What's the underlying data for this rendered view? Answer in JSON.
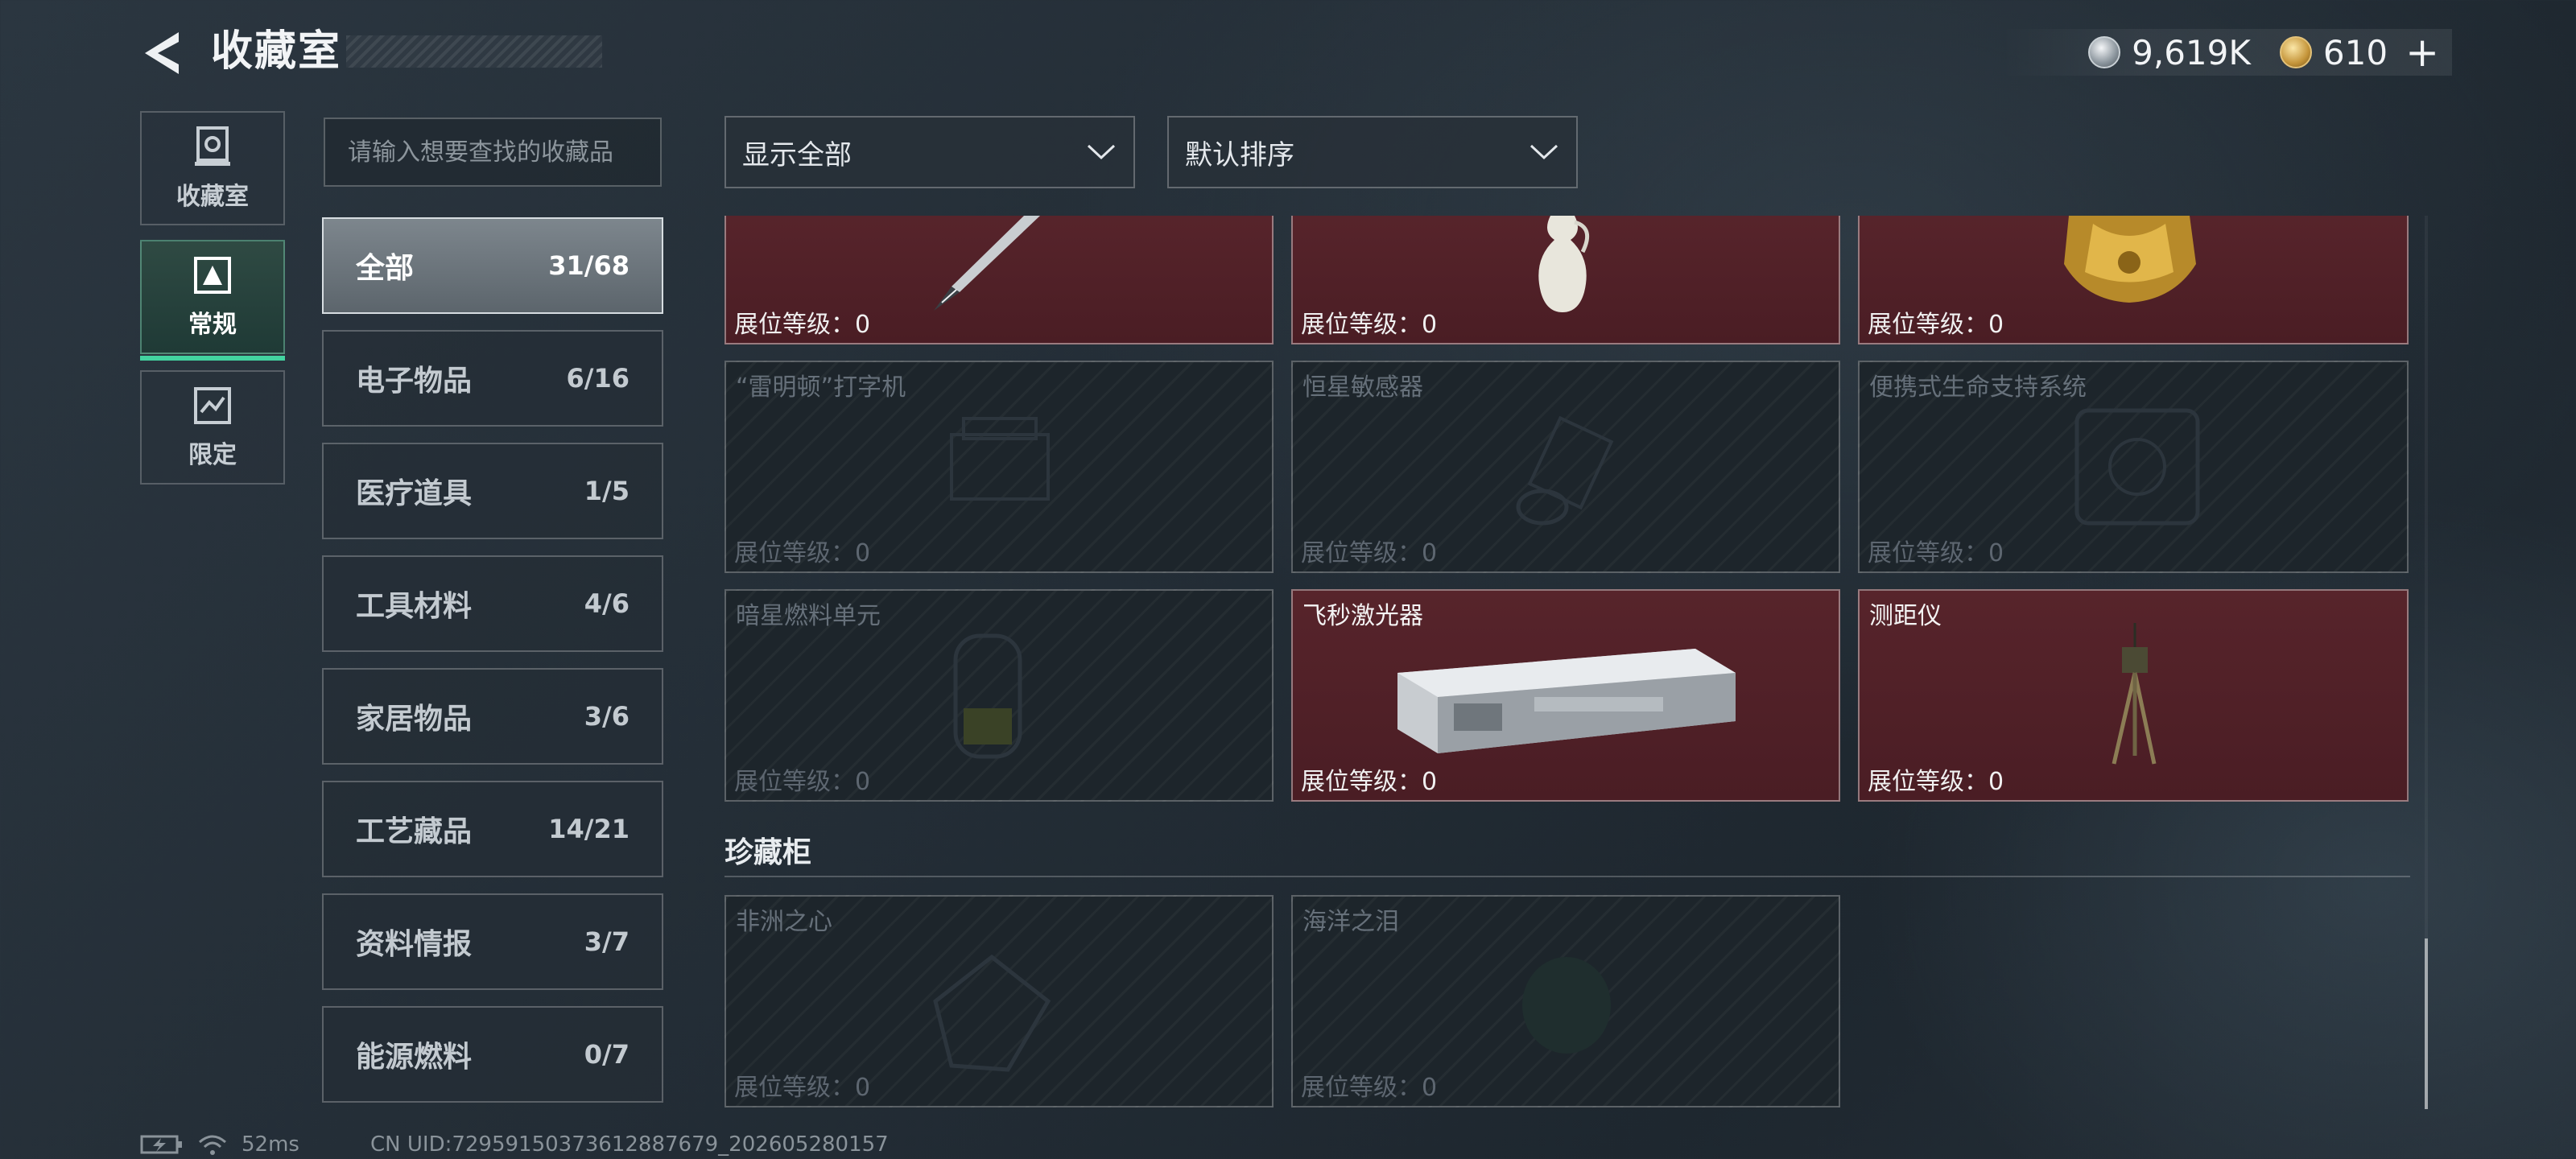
{
  "header": {
    "title": "收藏室",
    "currency_silver": "9,619K",
    "currency_gold": "610",
    "add_symbol": "+"
  },
  "rail": [
    {
      "label": "收藏室",
      "icon": "vault-icon",
      "active": false
    },
    {
      "label": "常规",
      "icon": "regular-collection-icon",
      "active": true
    },
    {
      "label": "限定",
      "icon": "limited-collection-icon",
      "active": false
    }
  ],
  "search": {
    "placeholder": "请输入想要查找的收藏品"
  },
  "filters": {
    "display": "显示全部",
    "sort": "默认排序"
  },
  "categories": [
    {
      "name": "全部",
      "count": "31/68",
      "active": true
    },
    {
      "name": "电子物品",
      "count": "6/16"
    },
    {
      "name": "医疗道具",
      "count": "1/5"
    },
    {
      "name": "工具材料",
      "count": "4/6"
    },
    {
      "name": "家居物品",
      "count": "3/6"
    },
    {
      "name": "工艺藏品",
      "count": "14/21"
    },
    {
      "name": "资料情报",
      "count": "3/7"
    },
    {
      "name": "能源燃料",
      "count": "0/7"
    }
  ],
  "items": [
    {
      "name": "",
      "level": "展位等级：0",
      "owned": true
    },
    {
      "name": "",
      "level": "展位等级：0",
      "owned": true
    },
    {
      "name": "",
      "level": "展位等级：0",
      "owned": true
    },
    {
      "name": "“雷明顿”打字机",
      "level": "展位等级：0",
      "owned": false
    },
    {
      "name": "恒星敏感器",
      "level": "展位等级：0",
      "owned": false
    },
    {
      "name": "便携式生命支持系统",
      "level": "展位等级：0",
      "owned": false
    },
    {
      "name": "暗星燃料单元",
      "level": "展位等级：0",
      "owned": false
    },
    {
      "name": "飞秒激光器",
      "level": "展位等级：0",
      "owned": true
    },
    {
      "name": "测距仪",
      "level": "展位等级：0",
      "owned": true
    }
  ],
  "showcase": {
    "title": "珍藏柜",
    "items": [
      {
        "name": "非洲之心",
        "level": "展位等级：0",
        "owned": false
      },
      {
        "name": "海洋之泪",
        "level": "展位等级：0",
        "owned": false
      }
    ]
  },
  "footer": {
    "ping": "52ms",
    "uid": "CN UID:7295915037361288767​9_202605280157"
  },
  "colors": {
    "accent": "#43d3a0",
    "owned_card": "#57242b",
    "locked_card": "#1d252b"
  }
}
